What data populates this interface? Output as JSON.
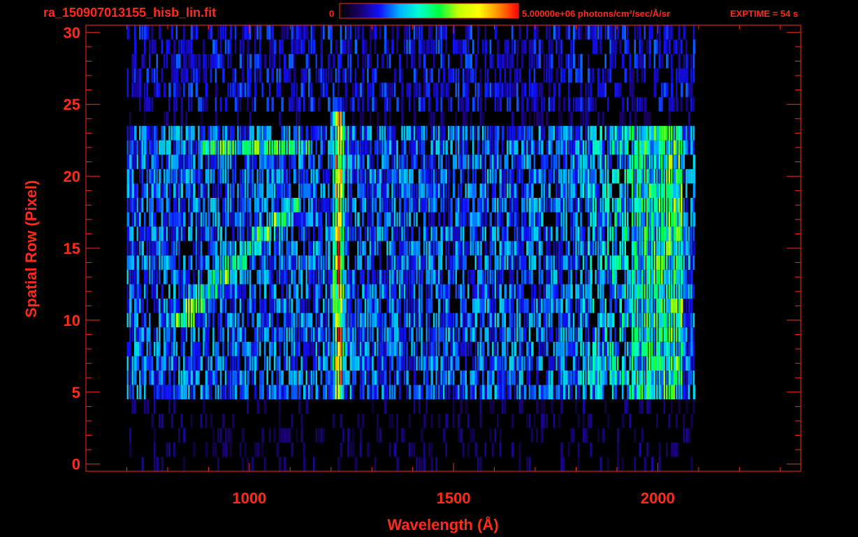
{
  "header": {
    "filename": "ra_150907013155_hisb_lin.fit",
    "colorbar_min_label": "0",
    "colorbar_max_label": "5.00000e+06 photons/cm²/sec/Å/sr",
    "exptime_label": "EXPTIME = 54 s"
  },
  "colors": {
    "background": "#000000",
    "axis": "#ff2a1a",
    "colormap": [
      "#000000",
      "#1a0066",
      "#1010ff",
      "#00b0ff",
      "#00ffd0",
      "#00ff40",
      "#c8ff00",
      "#ffff00",
      "#ff8c00",
      "#ff0000"
    ]
  },
  "chart_data": {
    "type": "heatmap",
    "title": "",
    "xlabel": "Wavelength (Å)",
    "ylabel": "Spatial Row (Pixel)",
    "xlim": [
      600,
      2350
    ],
    "ylim": [
      -0.5,
      30.5
    ],
    "x_ticks": [
      1000,
      1500,
      2000
    ],
    "y_ticks": [
      0,
      5,
      10,
      15,
      20,
      25,
      30
    ],
    "x_minor_step": 100,
    "y_minor_step": 1,
    "colorbar": {
      "min": 0,
      "max": 5000000,
      "unit": "photons/cm²/sec/Å/sr"
    },
    "grid": false,
    "rows": 31,
    "detector_range": [
      700,
      2090
    ],
    "bright_band_rows": [
      5,
      23
    ],
    "features": [
      {
        "name": "Lyman-alpha line",
        "wavelength": 1216,
        "rows": [
          5,
          24
        ],
        "level": 0.85
      },
      {
        "name": "curved diagonal arc",
        "from": [
          830,
          10
        ],
        "to": [
          1100,
          18
        ],
        "level": 0.55
      },
      {
        "name": "upper left streak",
        "from": [
          900,
          22
        ],
        "to": [
          1130,
          22
        ],
        "level": 0.5
      },
      {
        "name": "hot spot",
        "wavelength": 850,
        "rows": [
          10,
          11
        ],
        "level": 0.85
      },
      {
        "name": "long-wavelength continuum",
        "wavelength": [
          1800,
          2060
        ],
        "rows": [
          5,
          23
        ],
        "level": 0.55
      }
    ]
  }
}
